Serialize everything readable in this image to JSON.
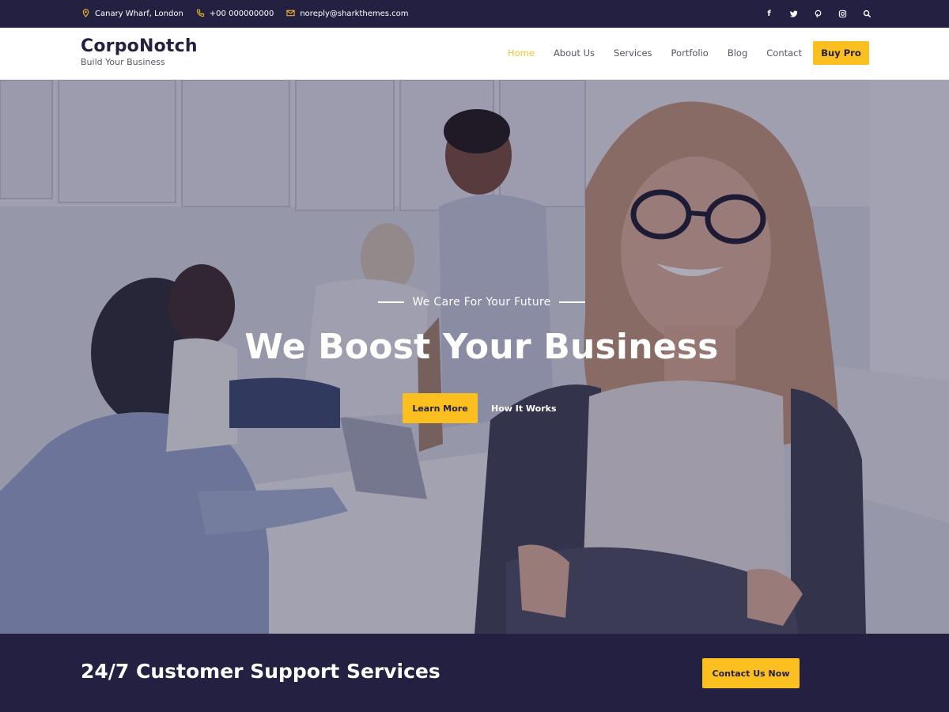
{
  "topbar": {
    "address": "Canary Wharf, London",
    "phone": "+00 000000000",
    "email": "noreply@sharkthemes.com",
    "social_icons": [
      "facebook-icon",
      "twitter-icon",
      "pinterest-icon",
      "instagram-icon",
      "search-icon"
    ]
  },
  "header": {
    "site_name": "CorpoNotch",
    "tagline": "Build Your Business",
    "nav": [
      {
        "label": "Home",
        "active": true
      },
      {
        "label": "About Us",
        "active": false
      },
      {
        "label": "Services",
        "active": false
      },
      {
        "label": "Portfolio",
        "active": false
      },
      {
        "label": "Blog",
        "active": false
      },
      {
        "label": "Contact",
        "active": false
      }
    ],
    "buy_label": "Buy Pro"
  },
  "hero": {
    "eyebrow": "We Care For Your Future",
    "title": "We Boost Your Business",
    "primary_button": "Learn More",
    "secondary_button": "How It Works"
  },
  "cta": {
    "text": "24/7 Customer Support Services",
    "button": "Contact Us Now"
  },
  "colors": {
    "primary_dark": "#232041",
    "accent": "#fbc020",
    "active_nav": "#f7c331"
  }
}
